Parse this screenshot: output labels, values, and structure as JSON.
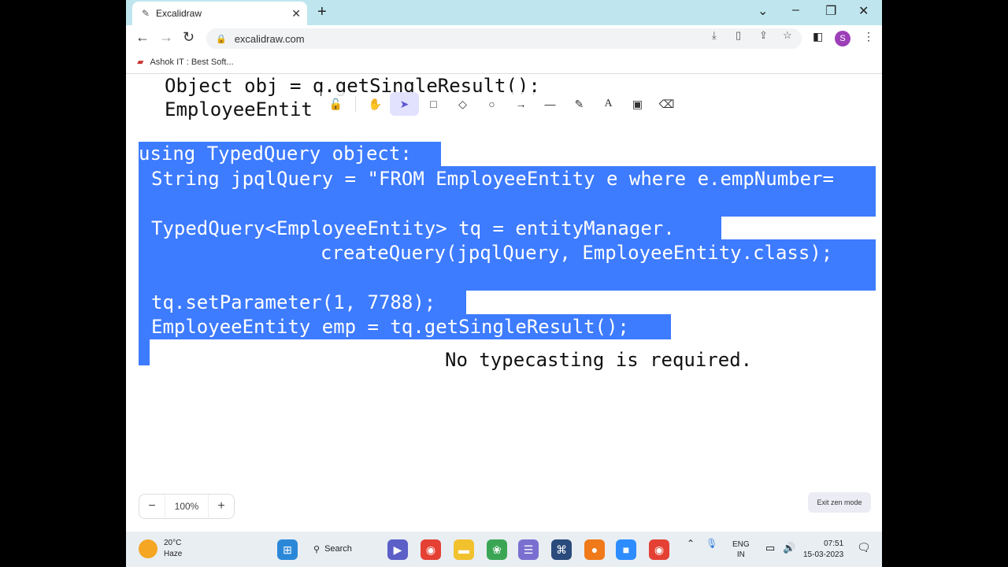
{
  "browser": {
    "tab_title": "Excalidraw",
    "url": "excalidraw.com",
    "bookmark_label": "Ashok IT : Best Soft...",
    "profile_initial": "S"
  },
  "canvas": {
    "line1": "Object obj = q.getSingleResult();",
    "line2": "EmployeeEntit",
    "heading": "using TypedQuery object:",
    "code1": "String jpqlQuery = \"FROM EmployeeEntity e where e.empNumber=",
    "code2": "TypedQuery<EmployeeEntity> tq = entityManager.",
    "code3": "createQuery(jpqlQuery, EmployeeEntity.class);",
    "code4": "tq.setParameter(1, 7788);",
    "code5": "EmployeeEntity emp = tq.getSingleResult();",
    "note": "No typecasting is required."
  },
  "zoom": {
    "minus": "−",
    "value": "100%",
    "plus": "+"
  },
  "exit_zen": "Exit zen mode",
  "taskbar": {
    "temperature": "20°C",
    "condition": "Haze",
    "search_label": "Search",
    "lang1": "ENG",
    "lang2": "IN",
    "time": "07:51",
    "date": "15-03-2023"
  }
}
